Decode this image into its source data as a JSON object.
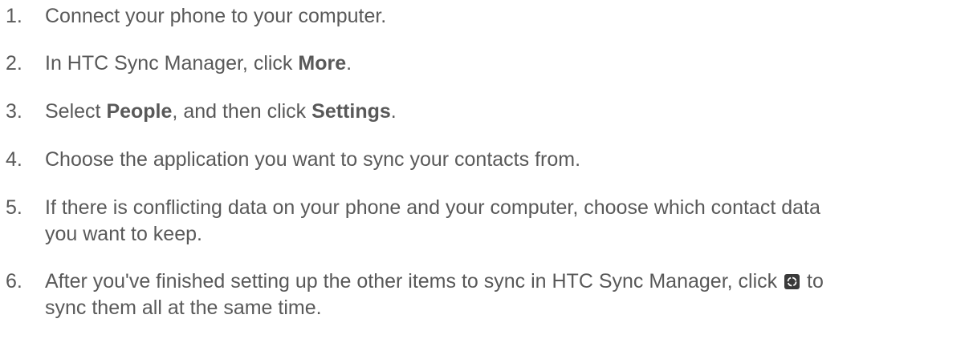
{
  "steps": [
    {
      "number": "1.",
      "text": "Connect your phone to your computer."
    },
    {
      "number": "2.",
      "text_before": "In HTC Sync Manager, click ",
      "bold": "More",
      "text_after": "."
    },
    {
      "number": "3.",
      "text_before": "Select ",
      "bold1": "People",
      "text_middle": ", and then click ",
      "bold2": "Settings",
      "text_after": "."
    },
    {
      "number": "4.",
      "text": "Choose the application you want to sync your contacts from."
    },
    {
      "number": "5.",
      "line1": "If there is conflicting data on your phone and your computer, choose which contact data",
      "line2": "you want to keep."
    },
    {
      "number": "6.",
      "line1_before": "After you've finished setting up the other items to sync in HTC Sync Manager, click ",
      "line1_after": " to",
      "line2": "sync them all at the same time.",
      "icon": "sync-icon"
    }
  ],
  "colors": {
    "text": "#595959",
    "icon_bg": "#3a3a3a",
    "icon_fg": "#ffffff"
  }
}
